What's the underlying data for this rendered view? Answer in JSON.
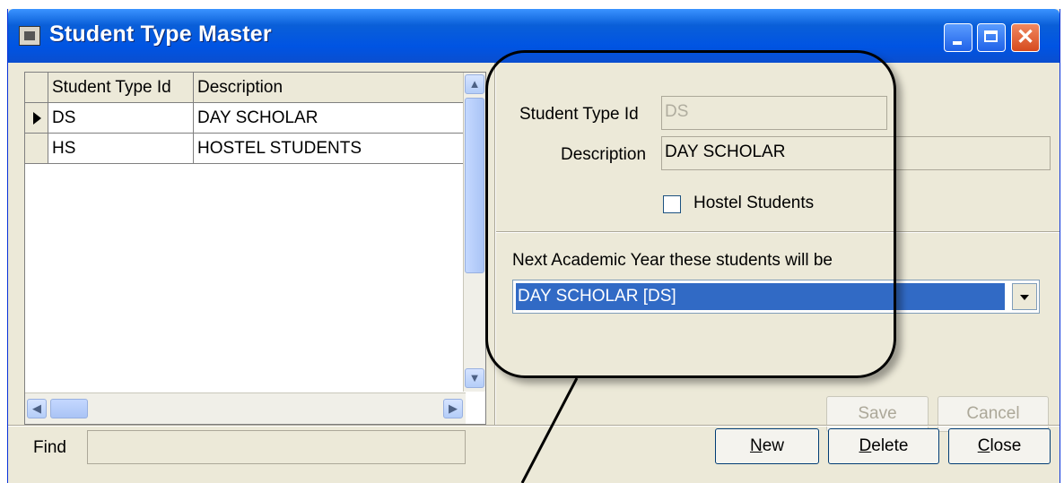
{
  "window": {
    "title": "Student Type Master",
    "close_glyph": "✕"
  },
  "grid": {
    "columns": [
      "Student Type Id",
      "Description"
    ],
    "rows": [
      {
        "id": "DS",
        "description": "DAY SCHOLAR",
        "current": true
      },
      {
        "id": "HS",
        "description": "HOSTEL STUDENTS",
        "current": false
      }
    ]
  },
  "form": {
    "student_type_id_label": "Student Type Id",
    "student_type_id_value": "DS",
    "description_label": "Description",
    "description_value": "DAY SCHOLAR",
    "hostel_label": "Hostel Students",
    "hostel_checked": false,
    "next_year_label": "Next Academic Year these students will be",
    "next_year_value": "DAY SCHOLAR [DS]"
  },
  "buttons": {
    "save": "Save",
    "cancel": "Cancel",
    "new": "New",
    "delete": "Delete",
    "close": "Close"
  },
  "find": {
    "label": "Find",
    "value": ""
  },
  "icons": [
    "app-icon",
    "minimize-icon",
    "maximize-icon",
    "close-icon",
    "row-pointer-icon",
    "scroll-up-icon",
    "scroll-down-icon",
    "scroll-left-icon",
    "scroll-right-icon",
    "dropdown-arrow-icon"
  ],
  "colors": {
    "title_bar": "#0054e3",
    "selection": "#316ac5",
    "window_bg": "#ece9d8"
  }
}
